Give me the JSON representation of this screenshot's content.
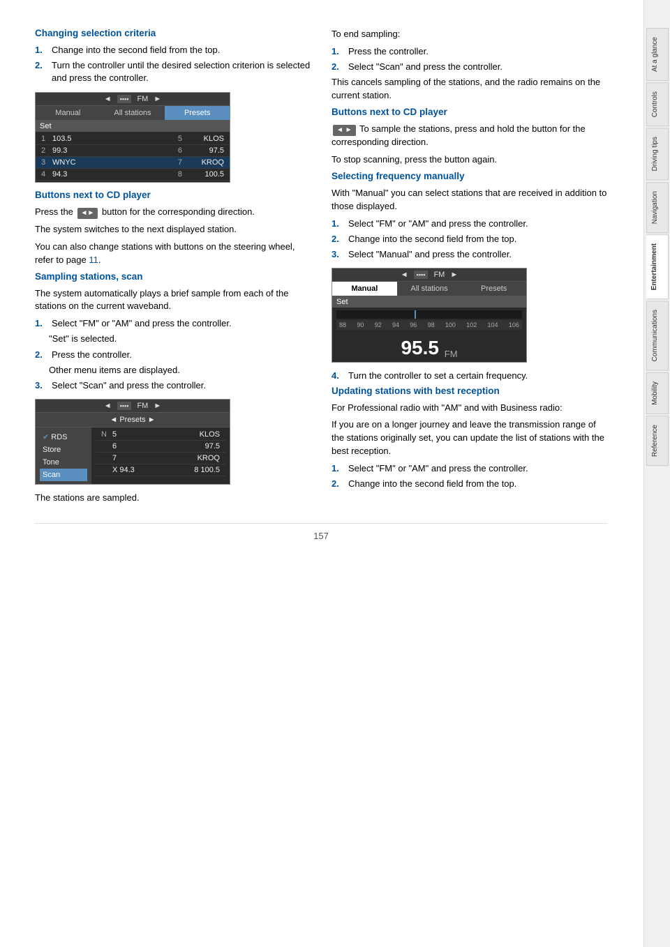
{
  "sidebar": {
    "tabs": [
      {
        "label": "At a glance",
        "active": false
      },
      {
        "label": "Controls",
        "active": false
      },
      {
        "label": "Driving tips",
        "active": false
      },
      {
        "label": "Navigation",
        "active": false
      },
      {
        "label": "Entertainment",
        "active": true
      },
      {
        "label": "Communications",
        "active": false
      },
      {
        "label": "Mobility",
        "active": false
      },
      {
        "label": "Reference",
        "active": false
      }
    ]
  },
  "left": {
    "section1": {
      "title": "Changing selection criteria",
      "steps": [
        "Change into the second field from the top.",
        "Turn the controller until the desired selection criterion is selected and press the controller."
      ],
      "screen1": {
        "header": "FM",
        "tabs": [
          "Manual",
          "All stations",
          "Presets"
        ],
        "active_tab": "Presets",
        "row_header": "Set",
        "stations": [
          {
            "num": "1",
            "freq": "103.5",
            "num2": "5",
            "freq2": "KLOS"
          },
          {
            "num": "2",
            "freq": "99.3",
            "num2": "6",
            "freq2": "97.5"
          },
          {
            "num": "3",
            "freq": "WNYC",
            "num2": "7",
            "freq2": "KROQ"
          },
          {
            "num": "4",
            "freq": "94.3",
            "num2": "8",
            "freq2": "100.5"
          }
        ]
      }
    },
    "section2": {
      "title": "Buttons next to CD player",
      "text1": "Press the [◄►] button for the corresponding direction.",
      "text2": "The system switches to the next displayed station.",
      "text3": "You can also change stations with buttons on the steering wheel, refer to page 11."
    },
    "section3": {
      "title": "Sampling stations, scan",
      "intro": "The system automatically plays a brief sample from each of the stations on the current waveband.",
      "steps": [
        {
          "text": "Select \"FM\" or \"AM\" and press the controller.",
          "sub": "\"Set\" is selected."
        },
        {
          "text": "Press the controller.",
          "sub": "Other menu items are displayed."
        },
        {
          "text": "Select \"Scan\" and press the controller."
        }
      ],
      "screen2": {
        "header": "FM",
        "presets_row": "◄ Presets ►",
        "menu_items": [
          "RDS",
          "Store",
          "Tone",
          "Scan"
        ],
        "active_menu": "Scan",
        "right_stations": [
          {
            "num": "5",
            "freq": "KLOS"
          },
          {
            "num": "6",
            "freq": "97.5"
          },
          {
            "num": "7",
            "freq": "KROQ"
          },
          {
            "num": "8",
            "freq": "100.5"
          }
        ]
      },
      "footer": "The stations are sampled."
    }
  },
  "right": {
    "end_sampling": {
      "title": "To end sampling:",
      "steps": [
        "Press the controller.",
        "Select \"Scan\" and press the controller."
      ],
      "note1": "This cancels sampling of the stations, and the radio remains on the current station."
    },
    "section_buttons": {
      "title": "Buttons next to CD player",
      "text1": "To sample the stations, press and hold the button for the corresponding direction.",
      "text2": "To stop scanning, press the button again."
    },
    "section_freq": {
      "title": "Selecting frequency manually",
      "intro": "With \"Manual\" you can select stations that are received in addition to those displayed.",
      "steps": [
        "Select \"FM\" or \"AM\" and press the controller.",
        "Change into the second field from the top.",
        "Select \"Manual\" and press the controller."
      ],
      "screen": {
        "header": "FM",
        "tabs": [
          "Manual",
          "All stations",
          "Presets"
        ],
        "active_tab": "Manual",
        "scale": "88 90 92 94 96 98 100 102 104 106",
        "freq_display": "95.5",
        "freq_unit": "FM"
      },
      "step4": "Turn the controller to set a certain frequency."
    },
    "section_update": {
      "title": "Updating stations with best reception",
      "intro1": "For Professional radio with \"AM\" and with Business radio:",
      "intro2": "If you are on a longer journey and leave the transmission range of the stations originally set, you can update the list of stations with the best reception.",
      "steps": [
        "Select \"FM\" or \"AM\" and press the controller.",
        "Change into the second field from the top."
      ]
    }
  },
  "page_number": "157"
}
